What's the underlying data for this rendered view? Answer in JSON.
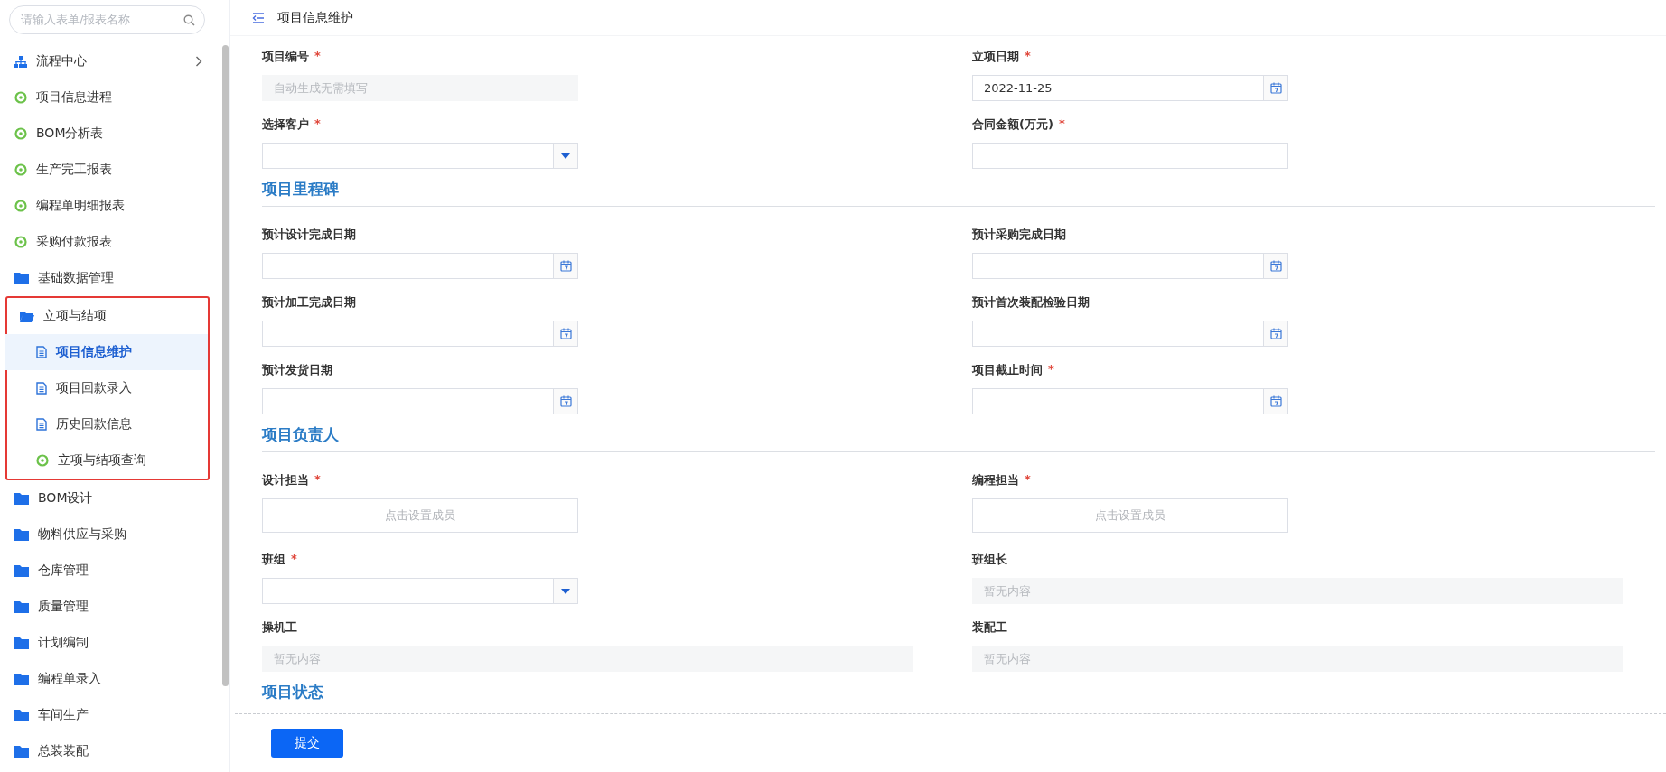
{
  "sidebar": {
    "search": {
      "placeholder": "请输入表单/报表名称"
    },
    "items": [
      {
        "kind": "flow",
        "label": "流程中心"
      },
      {
        "kind": "report",
        "label": "项目信息进程"
      },
      {
        "kind": "report",
        "label": "BOM分析表"
      },
      {
        "kind": "report",
        "label": "生产完工报表"
      },
      {
        "kind": "report",
        "label": "编程单明细报表"
      },
      {
        "kind": "report",
        "label": "采购付款报表"
      },
      {
        "kind": "folder",
        "label": "基础数据管理",
        "expanded": false
      },
      {
        "kind": "folder",
        "label": "立项与结项",
        "expanded": true,
        "highlighted": true,
        "children": [
          {
            "kind": "page",
            "label": "项目信息维护",
            "selected": true
          },
          {
            "kind": "page",
            "label": "项目回款录入",
            "selected": false
          },
          {
            "kind": "page",
            "label": "历史回款信息",
            "selected": false
          },
          {
            "kind": "report",
            "label": "立项与结项查询",
            "selected": false
          }
        ]
      },
      {
        "kind": "folder",
        "label": "BOM设计",
        "expanded": false
      },
      {
        "kind": "folder",
        "label": "物料供应与采购",
        "expanded": false
      },
      {
        "kind": "folder",
        "label": "仓库管理",
        "expanded": false
      },
      {
        "kind": "folder",
        "label": "质量管理",
        "expanded": false
      },
      {
        "kind": "folder",
        "label": "计划编制",
        "expanded": false
      },
      {
        "kind": "folder",
        "label": "编程单录入",
        "expanded": false
      },
      {
        "kind": "folder",
        "label": "车间生产",
        "expanded": false
      },
      {
        "kind": "folder",
        "label": "总装装配",
        "expanded": false
      }
    ]
  },
  "header": {
    "title": "项目信息维护"
  },
  "form": {
    "sections": [
      {
        "rows": [
          [
            {
              "label": "项目编号",
              "required_mark": "*",
              "kind": "auto",
              "placeholder": "自动生成无需填写"
            },
            {
              "label": "立项日期",
              "required_mark": "*",
              "kind": "date",
              "value": "2022-11-25"
            }
          ],
          [
            {
              "label": "选择客户",
              "required_mark": "*",
              "kind": "select"
            },
            {
              "label": "合同金额(万元)",
              "required_mark": "*",
              "kind": "text"
            }
          ]
        ]
      },
      {
        "heading": "项目里程碑",
        "rows": [
          [
            {
              "label": "预计设计完成日期",
              "kind": "date"
            },
            {
              "label": "预计采购完成日期",
              "kind": "date"
            }
          ],
          [
            {
              "label": "预计加工完成日期",
              "kind": "date"
            },
            {
              "label": "预计首次装配检验日期",
              "kind": "date"
            }
          ],
          [
            {
              "label": "预计发货日期",
              "kind": "date"
            },
            {
              "label": "项目截止时间",
              "required_mark": "*",
              "kind": "date"
            }
          ]
        ]
      },
      {
        "heading": "项目负责人",
        "rows": [
          [
            {
              "label": "设计担当",
              "required_mark": "*",
              "kind": "member",
              "placeholder": "点击设置成员"
            },
            {
              "label": "编程担当",
              "required_mark": "*",
              "kind": "member",
              "placeholder": "点击设置成员"
            }
          ],
          [
            {
              "label": "班组",
              "required_mark": "*",
              "kind": "select"
            },
            {
              "label": "班组长",
              "kind": "display",
              "placeholder": "暂无内容"
            }
          ],
          [
            {
              "label": "操机工",
              "kind": "display",
              "placeholder": "暂无内容"
            },
            {
              "label": "装配工",
              "kind": "display",
              "placeholder": "暂无内容"
            }
          ]
        ]
      },
      {
        "heading": "项目状态"
      }
    ]
  },
  "footer": {
    "submit": "提交"
  }
}
